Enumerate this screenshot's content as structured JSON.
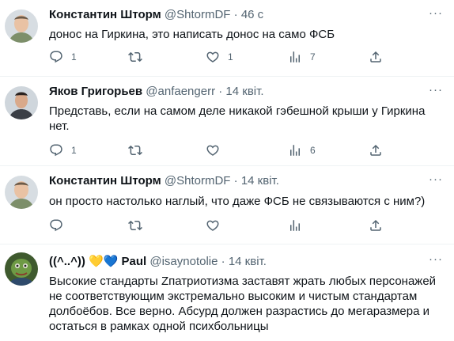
{
  "tweets": [
    {
      "name": "Константин Шторм",
      "handle": "@ShtormDF",
      "dot": "·",
      "time": "46 с",
      "text": "донос на Гиркина, это написать донос на само ФСБ",
      "replies": "1",
      "retweets": "",
      "likes": "1",
      "views": "7"
    },
    {
      "name": "Яков Григорьев",
      "handle": "@anfaengerr",
      "dot": "·",
      "time": "14 квіт.",
      "text": "Представь, если на самом деле никакой гэбешной крыши у Гиркина нет.",
      "replies": "1",
      "retweets": "",
      "likes": "",
      "views": "6"
    },
    {
      "name": "Константин Шторм",
      "handle": "@ShtormDF",
      "dot": "·",
      "time": "14 квіт.",
      "text": "он просто настолько наглый, что даже ФСБ не связываются с ним?)",
      "replies": "",
      "retweets": "",
      "likes": "",
      "views": ""
    },
    {
      "name": "((^..^)) 💛💙 Paul",
      "handle": "@isaynotolie",
      "dot": "·",
      "time": "14 квіт.",
      "text": "Высокие стандарты Zпатриотизма заставят жрать любых персонажей не соответствующим экстремально высоким и чистым стандартам долбоёбов. Все верно. Абсурд должен разрастись до мегаразмера и остаться в рамках одной психбольницы"
    }
  ],
  "icons": {
    "reply": "reply-icon",
    "retweet": "retweet-icon",
    "like": "heart-icon",
    "views": "views-icon",
    "share": "share-icon",
    "more": "more-icon"
  },
  "colors": {
    "text": "#0f1419",
    "secondary": "#536471",
    "divider": "#eff3f4",
    "thread_line": "#cfd9de"
  }
}
